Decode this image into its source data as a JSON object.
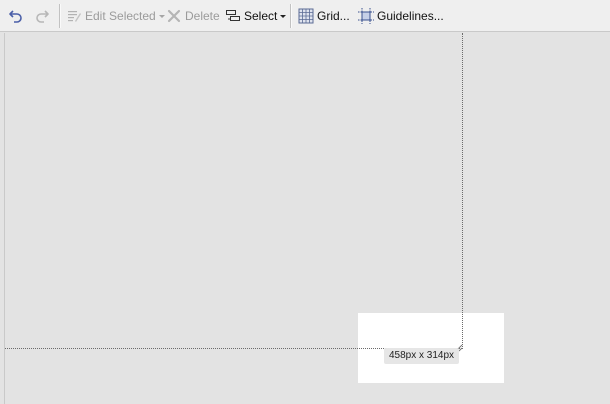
{
  "toolbar": {
    "undo": {
      "icon": "undo-icon",
      "enabled": true
    },
    "redo": {
      "icon": "redo-icon",
      "enabled": false
    },
    "edit_selected": {
      "label": "Edit Selected",
      "icon": "edit-selected-icon",
      "enabled": false
    },
    "delete": {
      "label": "Delete",
      "icon": "delete-icon",
      "enabled": false
    },
    "select": {
      "label": "Select",
      "icon": "select-icon",
      "enabled": true
    },
    "grid": {
      "label": "Grid...",
      "icon": "grid-icon",
      "enabled": true
    },
    "guidelines": {
      "label": "Guidelines...",
      "icon": "guidelines-icon",
      "enabled": true
    }
  },
  "canvas": {
    "size_label": "458px x 314px"
  },
  "colors": {
    "toolbar_bg": "#efefef",
    "workspace_bg": "#e3e3e3",
    "undo_accent": "#4a5fa8",
    "guideline": "#6b6b6b"
  }
}
